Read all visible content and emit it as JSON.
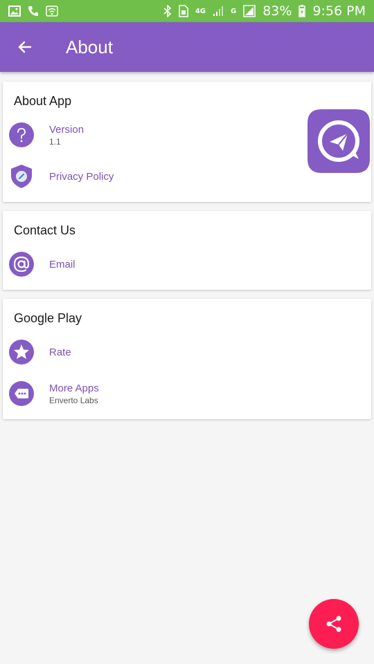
{
  "status_bar": {
    "battery": "83%",
    "time": "9:56 PM",
    "network_4g": "4G",
    "network_g": "G",
    "icons": [
      "image-icon",
      "phone-icon",
      "wifi-icon",
      "bluetooth-icon",
      "sim-icon",
      "signal-icon",
      "battery-icon"
    ]
  },
  "app_bar": {
    "title": "About",
    "back_icon": "arrow-back-icon"
  },
  "sections": {
    "about_app": {
      "title": "About App",
      "version_label": "Version",
      "version_value": "1.1",
      "privacy_label": "Privacy Policy",
      "logo_icon": "app-logo-paper-plane-icon"
    },
    "contact_us": {
      "title": "Contact Us",
      "email_label": "Email"
    },
    "google_play": {
      "title": "Google Play",
      "rate_label": "Rate",
      "more_apps_label": "More Apps",
      "more_apps_sub": "Enverto Labs"
    }
  },
  "fab": {
    "icon": "share-icon"
  },
  "colors": {
    "status_bar": "#6fbf4a",
    "accent": "#845cc4",
    "fab": "#fc1d52"
  }
}
